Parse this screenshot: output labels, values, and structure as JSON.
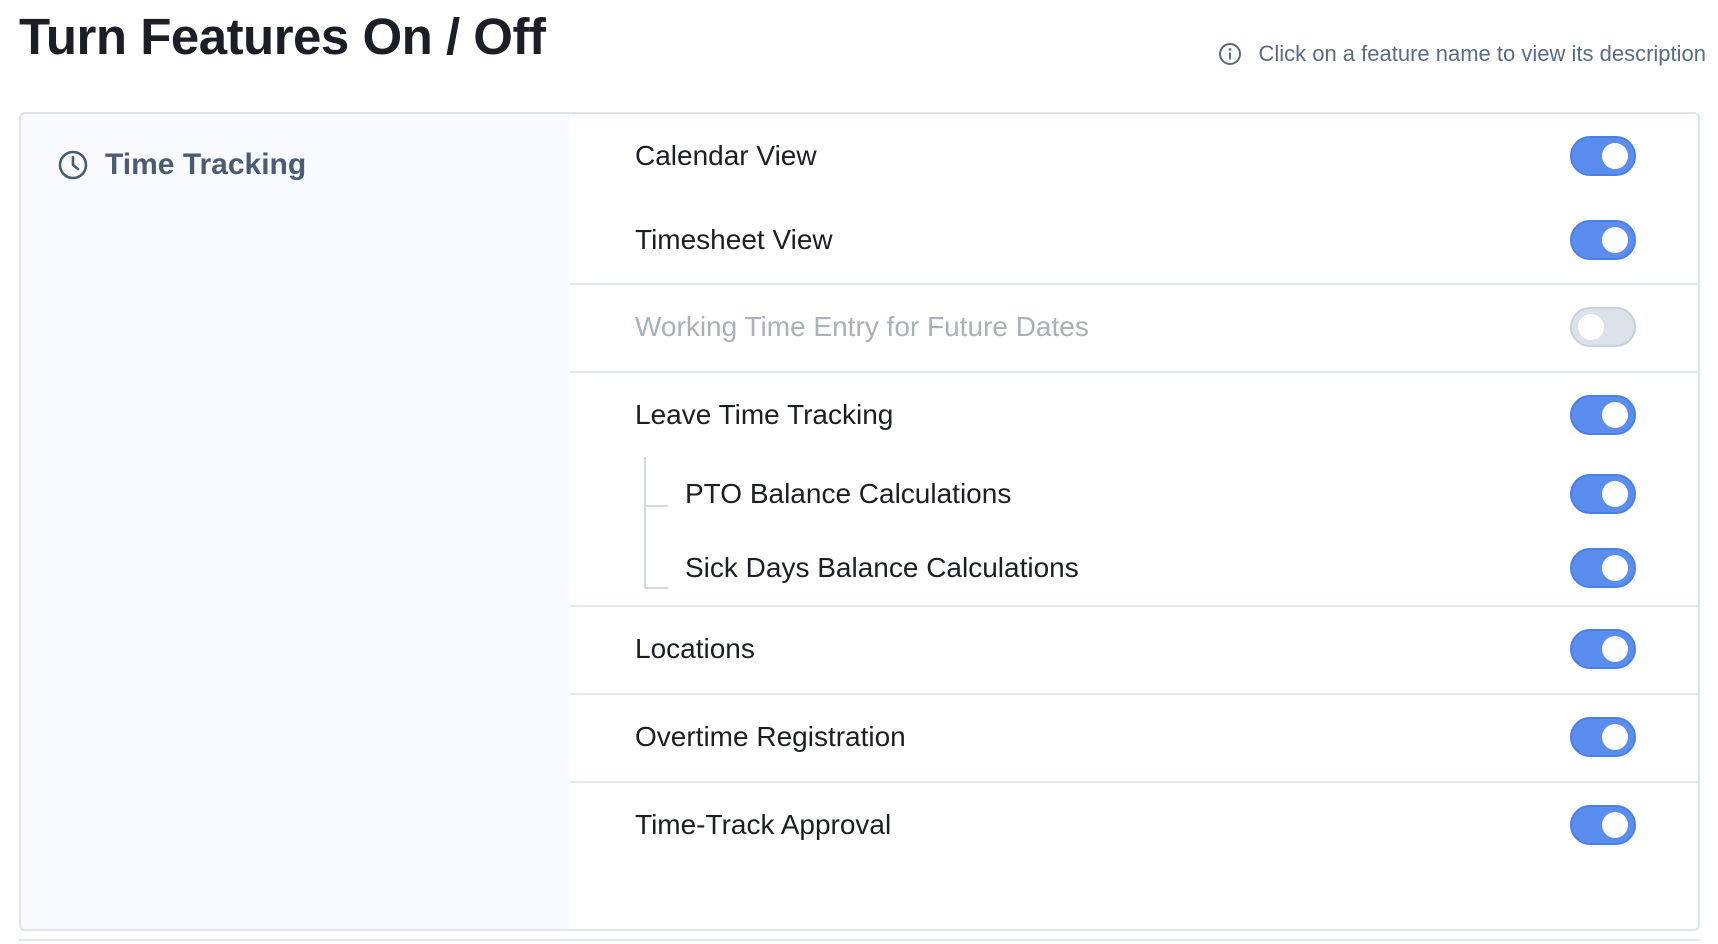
{
  "page": {
    "title": "Turn Features On / Off",
    "hint": "Click on a feature name to view its description"
  },
  "category": {
    "label": "Time Tracking",
    "icon": "clock-icon"
  },
  "features": {
    "calendar_view": {
      "label": "Calendar View",
      "enabled": true
    },
    "timesheet_view": {
      "label": "Timesheet View",
      "enabled": true
    },
    "future_dates": {
      "label": "Working Time Entry for Future Dates",
      "enabled": false
    },
    "leave_tracking": {
      "label": "Leave Time Tracking",
      "enabled": true
    },
    "pto_balance": {
      "label": "PTO Balance Calculations",
      "enabled": true
    },
    "sick_balance": {
      "label": "Sick Days Balance Calculations",
      "enabled": true
    },
    "locations": {
      "label": "Locations",
      "enabled": true
    },
    "overtime": {
      "label": "Overtime Registration",
      "enabled": true
    },
    "approval": {
      "label": "Time-Track Approval",
      "enabled": true
    }
  },
  "colors": {
    "toggle_on": "#5b8def",
    "toggle_off": "#dde2ea",
    "title": "#1b1e24",
    "muted": "#5a6b83"
  }
}
